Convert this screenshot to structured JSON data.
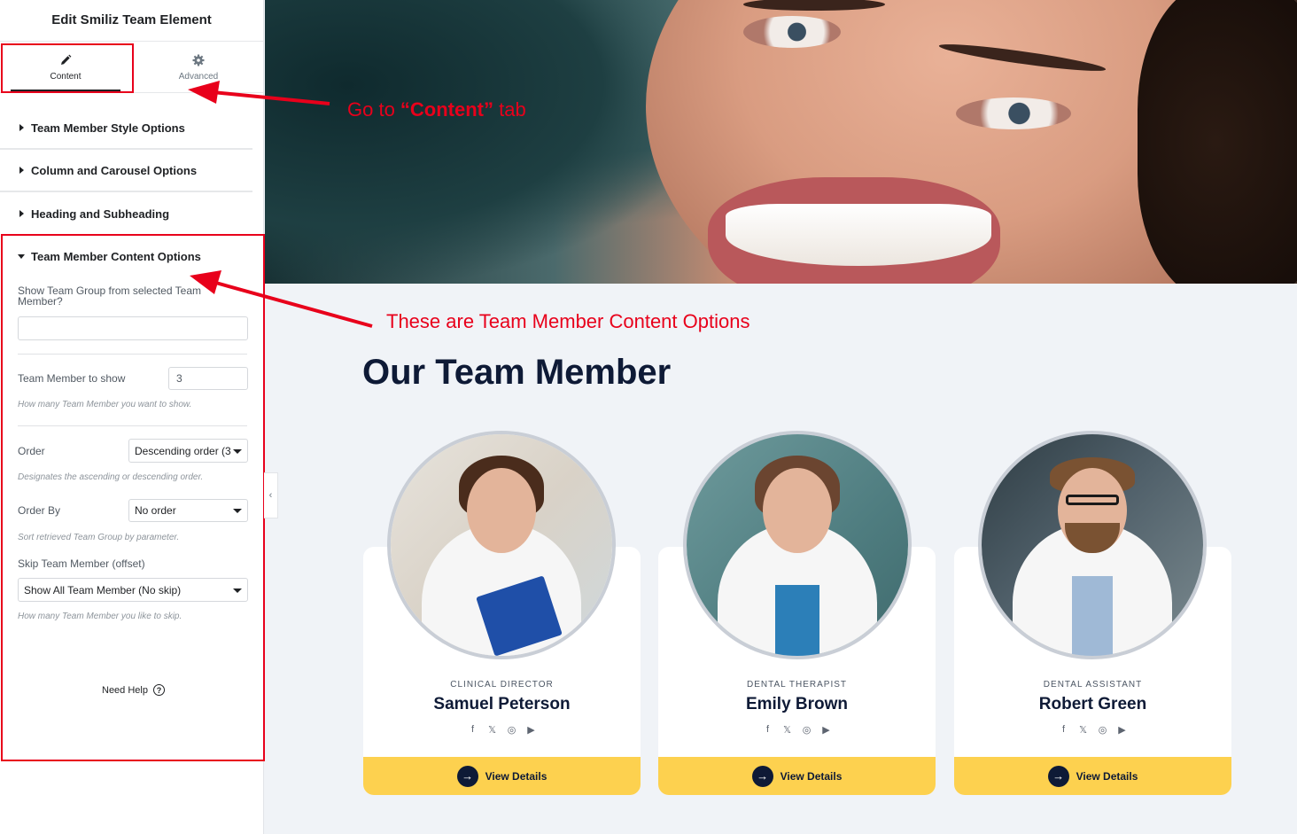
{
  "panel": {
    "title": "Edit Smiliz Team Element",
    "tabs": [
      {
        "label": "Content",
        "icon": "pencil-icon"
      },
      {
        "label": "Advanced",
        "icon": "gear-icon"
      }
    ],
    "sections": [
      {
        "label": "Team Member Style Options"
      },
      {
        "label": "Column and Carousel Options"
      },
      {
        "label": "Heading and Subheading"
      }
    ],
    "open_section": {
      "label": "Team Member Content Options",
      "show_group_label": "Show Team Group from selected Team Member?",
      "show_group_value": "",
      "to_show_label": "Team Member to show",
      "to_show_value": "3",
      "to_show_help": "How many Team Member you want to show.",
      "order_label": "Order",
      "order_value": "Descending order (3",
      "order_help": "Designates the ascending or descending order.",
      "orderby_label": "Order By",
      "orderby_value": "No order",
      "orderby_help": "Sort retrieved Team Group by parameter.",
      "skip_label": "Skip Team Member (offset)",
      "skip_value": "Show All Team Member (No skip)",
      "skip_help": "How many Team Member you like to skip."
    },
    "need_help": "Need Help",
    "help_icon": "?",
    "collapse_icon": "‹"
  },
  "annotations": {
    "tab_note_prefix": "Go  to ",
    "tab_note_strong": "“Content”",
    "tab_note_suffix": " tab",
    "options_note": "These are Team Member Content Options",
    "color": "#e8001b"
  },
  "team": {
    "heading": "Our Team Member",
    "button_label": "View Details",
    "button_icon": "→",
    "social_icons": [
      "f",
      "𝕏",
      "◎",
      "▶"
    ],
    "members": [
      {
        "role": "CLINICAL DIRECTOR",
        "name": "Samuel Peterson"
      },
      {
        "role": "DENTAL THERAPIST",
        "name": "Emily Brown"
      },
      {
        "role": "DENTAL ASSISTANT",
        "name": "Robert Green"
      }
    ],
    "accent": "#fdd14f",
    "dark": "#0e1a36"
  }
}
